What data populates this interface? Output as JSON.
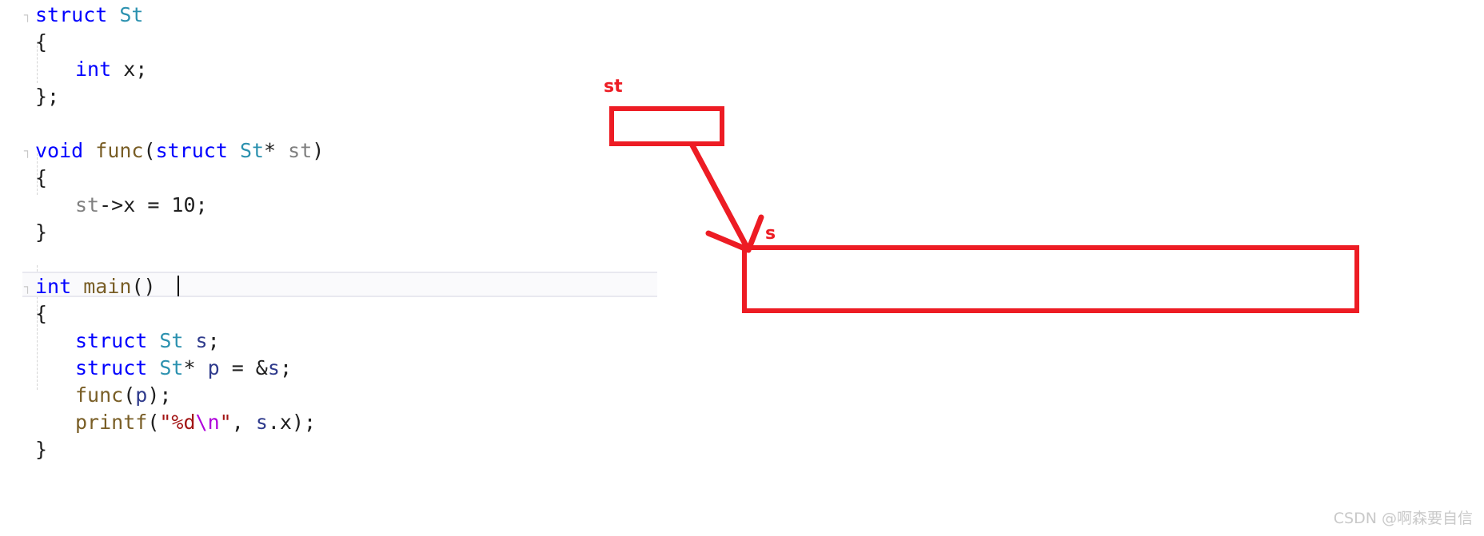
{
  "editor": {
    "language": "c",
    "background_color": "#ffffff",
    "current_line_index": 9,
    "fold_marker": "⌐",
    "lines": [
      {
        "indent": 0,
        "fold": true,
        "tokens": [
          {
            "t": "struct",
            "c": "kw"
          },
          {
            "t": " ",
            "c": "pln"
          },
          {
            "t": "St",
            "c": "typ"
          }
        ]
      },
      {
        "indent": 0,
        "fold": false,
        "tokens": [
          {
            "t": "{",
            "c": "pln"
          }
        ]
      },
      {
        "indent": 1,
        "fold": false,
        "tokens": [
          {
            "t": "int",
            "c": "kw"
          },
          {
            "t": " x;",
            "c": "pln"
          }
        ]
      },
      {
        "indent": 0,
        "fold": false,
        "tokens": [
          {
            "t": "};",
            "c": "pln"
          }
        ]
      },
      {
        "indent": 0,
        "fold": false,
        "tokens": []
      },
      {
        "indent": 0,
        "fold": true,
        "tokens": [
          {
            "t": "void",
            "c": "kw"
          },
          {
            "t": " ",
            "c": "pln"
          },
          {
            "t": "func",
            "c": "fn"
          },
          {
            "t": "(",
            "c": "pln"
          },
          {
            "t": "struct",
            "c": "kw"
          },
          {
            "t": " ",
            "c": "pln"
          },
          {
            "t": "St",
            "c": "typ"
          },
          {
            "t": "* ",
            "c": "pln"
          },
          {
            "t": "st",
            "c": "par"
          },
          {
            "t": ")",
            "c": "pln"
          }
        ]
      },
      {
        "indent": 0,
        "fold": false,
        "tokens": [
          {
            "t": "{",
            "c": "pln"
          }
        ]
      },
      {
        "indent": 1,
        "fold": false,
        "tokens": [
          {
            "t": "st",
            "c": "par"
          },
          {
            "t": "->x = 10;",
            "c": "pln"
          }
        ]
      },
      {
        "indent": 0,
        "fold": false,
        "tokens": [
          {
            "t": "}",
            "c": "pln"
          }
        ]
      },
      {
        "indent": 0,
        "fold": false,
        "tokens": []
      },
      {
        "indent": 0,
        "fold": true,
        "tokens": [
          {
            "t": "int",
            "c": "kw"
          },
          {
            "t": " ",
            "c": "pln"
          },
          {
            "t": "main",
            "c": "fn"
          },
          {
            "t": "() ",
            "c": "pln"
          }
        ]
      },
      {
        "indent": 0,
        "fold": false,
        "tokens": [
          {
            "t": "{",
            "c": "pln"
          }
        ]
      },
      {
        "indent": 1,
        "fold": false,
        "tokens": [
          {
            "t": "struct",
            "c": "kw"
          },
          {
            "t": " ",
            "c": "pln"
          },
          {
            "t": "St",
            "c": "typ"
          },
          {
            "t": " ",
            "c": "pln"
          },
          {
            "t": "s",
            "c": "var"
          },
          {
            "t": ";",
            "c": "pln"
          }
        ]
      },
      {
        "indent": 1,
        "fold": false,
        "tokens": [
          {
            "t": "struct",
            "c": "kw"
          },
          {
            "t": " ",
            "c": "pln"
          },
          {
            "t": "St",
            "c": "typ"
          },
          {
            "t": "* ",
            "c": "pln"
          },
          {
            "t": "p",
            "c": "var"
          },
          {
            "t": " = &",
            "c": "pln"
          },
          {
            "t": "s",
            "c": "var"
          },
          {
            "t": ";",
            "c": "pln"
          }
        ]
      },
      {
        "indent": 1,
        "fold": false,
        "tokens": [
          {
            "t": "func",
            "c": "fn"
          },
          {
            "t": "(",
            "c": "pln"
          },
          {
            "t": "p",
            "c": "var"
          },
          {
            "t": ");",
            "c": "pln"
          }
        ]
      },
      {
        "indent": 1,
        "fold": false,
        "tokens": [
          {
            "t": "printf",
            "c": "fn"
          },
          {
            "t": "(",
            "c": "pln"
          },
          {
            "t": "\"%d",
            "c": "str"
          },
          {
            "t": "\\n",
            "c": "esc"
          },
          {
            "t": "\"",
            "c": "str"
          },
          {
            "t": ", ",
            "c": "pln"
          },
          {
            "t": "s",
            "c": "var"
          },
          {
            "t": ".x);",
            "c": "pln"
          }
        ]
      },
      {
        "indent": 0,
        "fold": false,
        "tokens": [
          {
            "t": "}",
            "c": "pln"
          }
        ]
      }
    ]
  },
  "annotations": {
    "color": "#ed1c24",
    "st_label": "st",
    "s_label": "s",
    "pointer_box_title": "st",
    "target_box_title": "s"
  },
  "watermark": {
    "text": "CSDN @啊森要自信"
  }
}
